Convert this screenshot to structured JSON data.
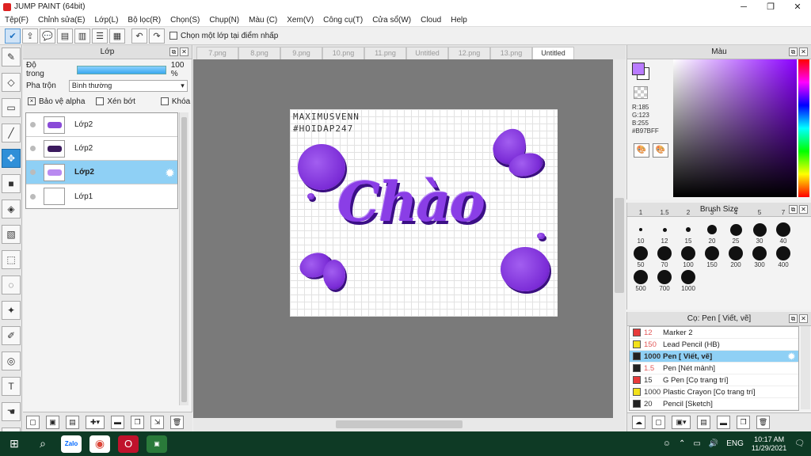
{
  "window": {
    "title": "JUMP PAINT (64bit)",
    "minimize": "─",
    "maximize": "❐",
    "close": "✕"
  },
  "menu": [
    "Tệp(F)",
    "Chỉnh sửa(E)",
    "Lớp(L)",
    "Bộ lọc(R)",
    "Chọn(S)",
    "Chụp(N)",
    "Màu (C)",
    "Xem(V)",
    "Công cụ(T)",
    "Cửa sổ(W)",
    "Cloud",
    "Help"
  ],
  "toolbar": {
    "select_layer_label": "Chọn một lớp tại điểm nhấp"
  },
  "layer_panel": {
    "title": "Lớp",
    "opacity_label": "Độ trong",
    "opacity_value": "100 %",
    "blend_label": "Pha trộn",
    "blend_value": "Bình thường",
    "protect_alpha": "Bảo vệ alpha",
    "clip": "Xén bớt",
    "lock": "Khóa",
    "layers": [
      {
        "name": "Lớp2",
        "selected": false,
        "thumb": true
      },
      {
        "name": "Lớp2",
        "selected": false,
        "thumb": true
      },
      {
        "name": "Lớp2",
        "selected": true,
        "thumb": true
      },
      {
        "name": "Lớp1",
        "selected": false,
        "thumb": false
      }
    ]
  },
  "tabs": [
    "7.png",
    "8.png",
    "9.png",
    "10.png",
    "11.png",
    "Untitled",
    "12.png",
    "13.png",
    "Untitled"
  ],
  "canvas": {
    "signature_line1": "MAXIMUSVENN",
    "signature_line2": "#HOIDAP247",
    "art_text": "Chào"
  },
  "color_panel": {
    "title": "Màu",
    "r": "R:185",
    "g": "G:123",
    "b": "B:255",
    "hex": "#B97BFF",
    "main_color": "#B97BFF"
  },
  "brush_panel": {
    "title": "Brush Size",
    "top_labels": [
      "1",
      "1.5",
      "2",
      "3",
      "4",
      "5",
      "7"
    ],
    "sizes": [
      "10",
      "12",
      "15",
      "20",
      "25",
      "30",
      "40",
      "50",
      "70",
      "100",
      "150",
      "200",
      "300",
      "400",
      "500",
      "700",
      "1000"
    ]
  },
  "pen_panel": {
    "title": "Cọ: Pen [ Viết, vẽ]",
    "pens": [
      {
        "size": "12",
        "name": "Marker 2",
        "color": "#e83a3a",
        "red": true,
        "selected": false
      },
      {
        "size": "150",
        "name": "Lead Pencil (HB)",
        "color": "#f2e11a",
        "red": true,
        "selected": false
      },
      {
        "size": "1000",
        "name": "Pen [ Viết, vẽ]",
        "color": "#222222",
        "red": false,
        "selected": true
      },
      {
        "size": "1.5",
        "name": "Pen [Nét mảnh]",
        "color": "#222222",
        "red": true,
        "selected": false
      },
      {
        "size": "15",
        "name": "G Pen [Cọ trang trí]",
        "color": "#e83a3a",
        "red": false,
        "selected": false
      },
      {
        "size": "1000",
        "name": "Plastic Crayon [Cọ trang trí]",
        "color": "#f2e11a",
        "red": false,
        "selected": false
      },
      {
        "size": "20",
        "name": "Pencil [Sketch]",
        "color": "#222222",
        "red": false,
        "selected": false
      }
    ]
  },
  "taskbar": {
    "zalo": "Zalo",
    "lang": "ENG",
    "time": "10:17 AM",
    "date": "11/29/2021"
  }
}
